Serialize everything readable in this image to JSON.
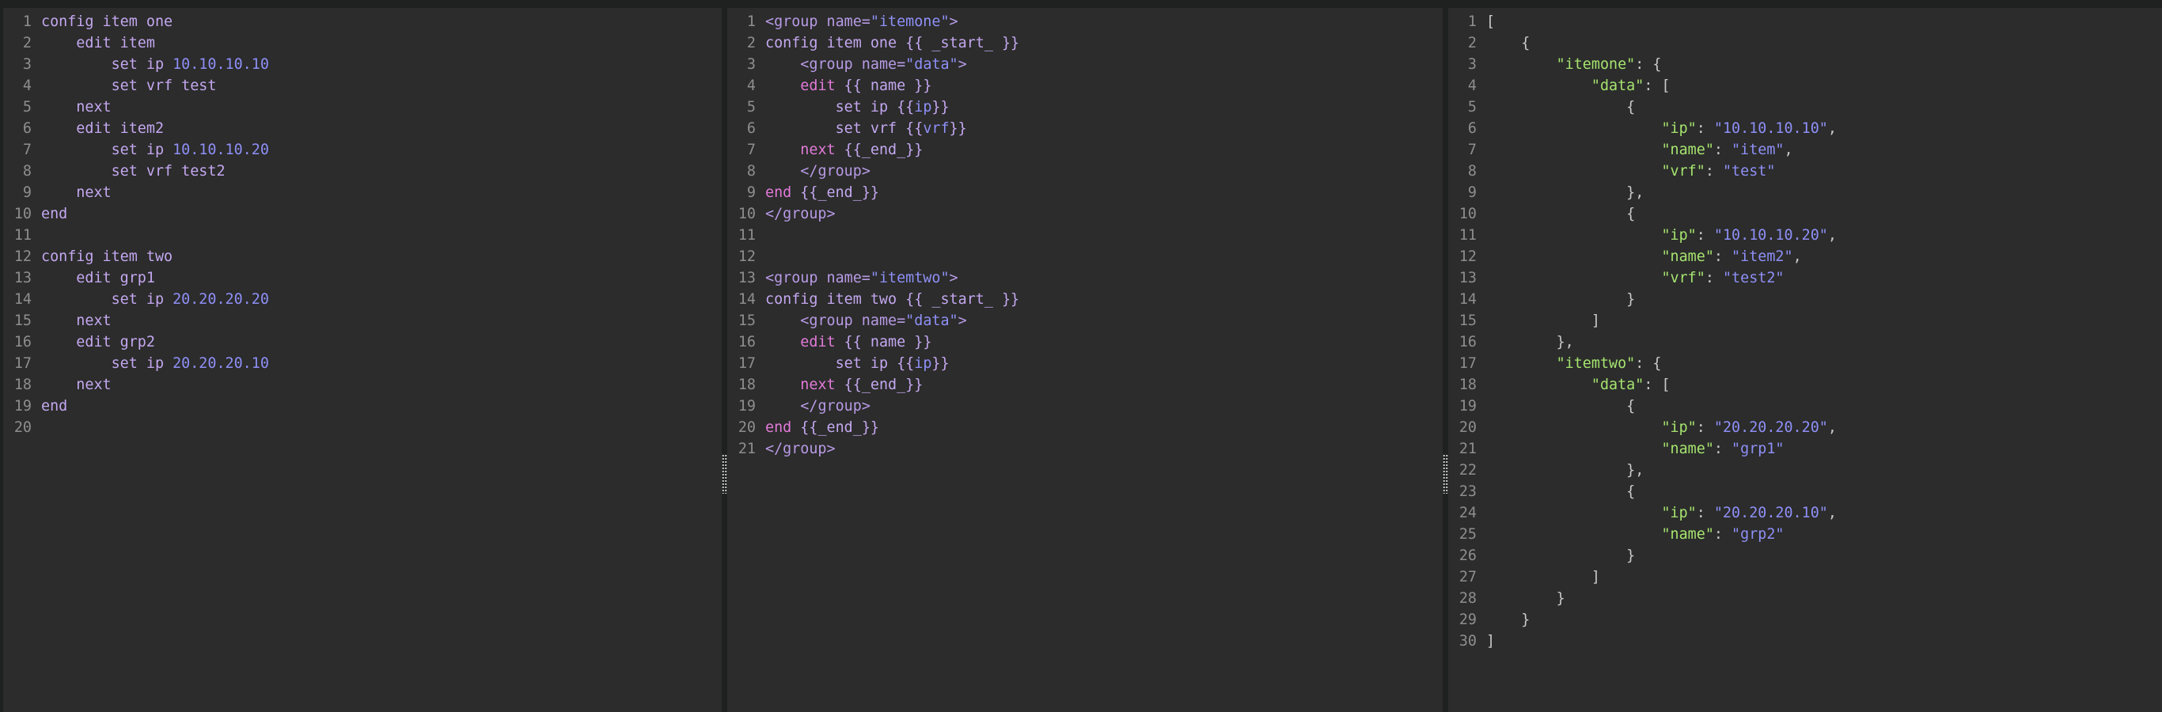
{
  "colors": {
    "background": "#2b2c2b",
    "divider": "#1f2020",
    "line_number": "#8e8e8e",
    "keyword": "#c4a7f0",
    "template_keyword": "#e27ad9",
    "value": "#8f8ff7",
    "json_key": "#a6e36f",
    "punctuation": "#c9c9c9"
  },
  "panes": [
    {
      "name": "data",
      "lines": [
        "config item one",
        "    edit item",
        "        set ip 10.10.10.10",
        "        set vrf test",
        "    next",
        "    edit item2",
        "        set ip 10.10.10.20",
        "        set vrf test2",
        "    next",
        "end",
        "",
        "config item two",
        "    edit grp1",
        "        set ip 20.20.20.20",
        "    next",
        "    edit grp2",
        "        set ip 20.20.20.10",
        "    next",
        "end",
        ""
      ]
    },
    {
      "name": "template",
      "lines": [
        "<group name=\"itemone\">",
        "config item one {{ _start_ }}",
        "    <group name=\"data\">",
        "    edit {{ name }}",
        "        set ip {{ip}}",
        "        set vrf {{vrf}}",
        "    next {{_end_}}",
        "    </group>",
        "end {{_end_}}",
        "</group>",
        "",
        "",
        "<group name=\"itemtwo\">",
        "config item two {{ _start_ }}",
        "    <group name=\"data\">",
        "    edit {{ name }}",
        "        set ip {{ip}}",
        "    next {{_end_}}",
        "    </group>",
        "end {{_end_}}",
        "</group>"
      ]
    },
    {
      "name": "result",
      "lines": [
        "[",
        "    {",
        "        \"itemone\": {",
        "            \"data\": [",
        "                {",
        "                    \"ip\": \"10.10.10.10\",",
        "                    \"name\": \"item\",",
        "                    \"vrf\": \"test\"",
        "                },",
        "                {",
        "                    \"ip\": \"10.10.10.20\",",
        "                    \"name\": \"item2\",",
        "                    \"vrf\": \"test2\"",
        "                }",
        "            ]",
        "        },",
        "        \"itemtwo\": {",
        "            \"data\": [",
        "                {",
        "                    \"ip\": \"20.20.20.20\",",
        "                    \"name\": \"grp1\"",
        "                },",
        "                {",
        "                    \"ip\": \"20.20.20.10\",",
        "                    \"name\": \"grp2\"",
        "                }",
        "            ]",
        "        }",
        "    }",
        "]"
      ]
    }
  ]
}
